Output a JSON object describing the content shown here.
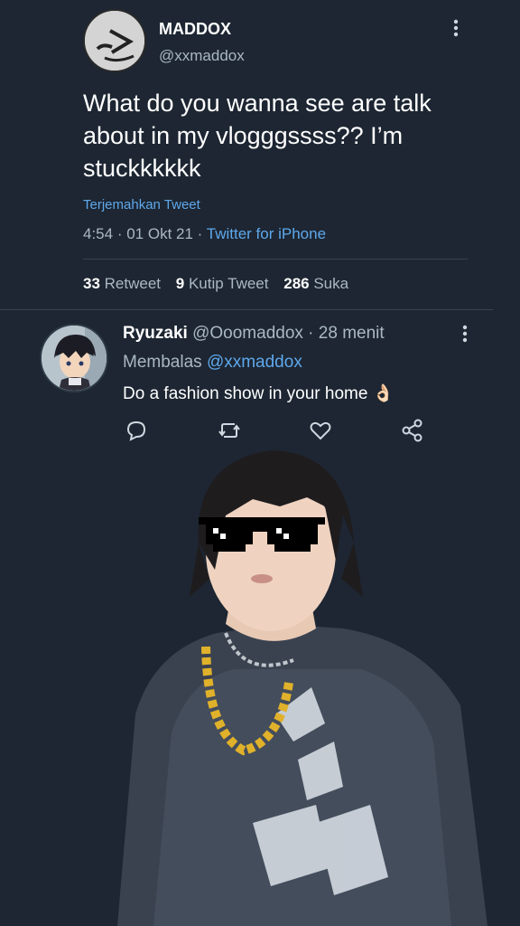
{
  "tweet": {
    "author_name": "MADDOX",
    "author_handle": "@xxmaddox",
    "text": "What do you wanna see are talk about in my vlogggssss?? I’m stuckkkkkk",
    "translate_label": "Terjemahkan Tweet",
    "time": "4:54",
    "date": "01 Okt 21",
    "source": "Twitter for iPhone",
    "stats": {
      "retweet_count": "33",
      "retweet_label": "Retweet",
      "quote_count": "9",
      "quote_label": "Kutip Tweet",
      "like_count": "286",
      "like_label": "Suka"
    }
  },
  "reply": {
    "name": "Ryuzaki",
    "handle": "@Ooomaddox",
    "time": "28 menit",
    "replying_prefix": "Membalas",
    "replying_to": "@xxmaddox",
    "text": "Do a fashion show in your home 👌🏻"
  },
  "icons": {
    "reply": "comment-icon",
    "retweet": "retweet-icon",
    "like": "heart-icon",
    "share": "share-icon",
    "more": "more-vertical-icon"
  },
  "colors": {
    "background": "#1d2632",
    "link": "#5ea8ec",
    "secondary_text": "#aab8c2"
  }
}
